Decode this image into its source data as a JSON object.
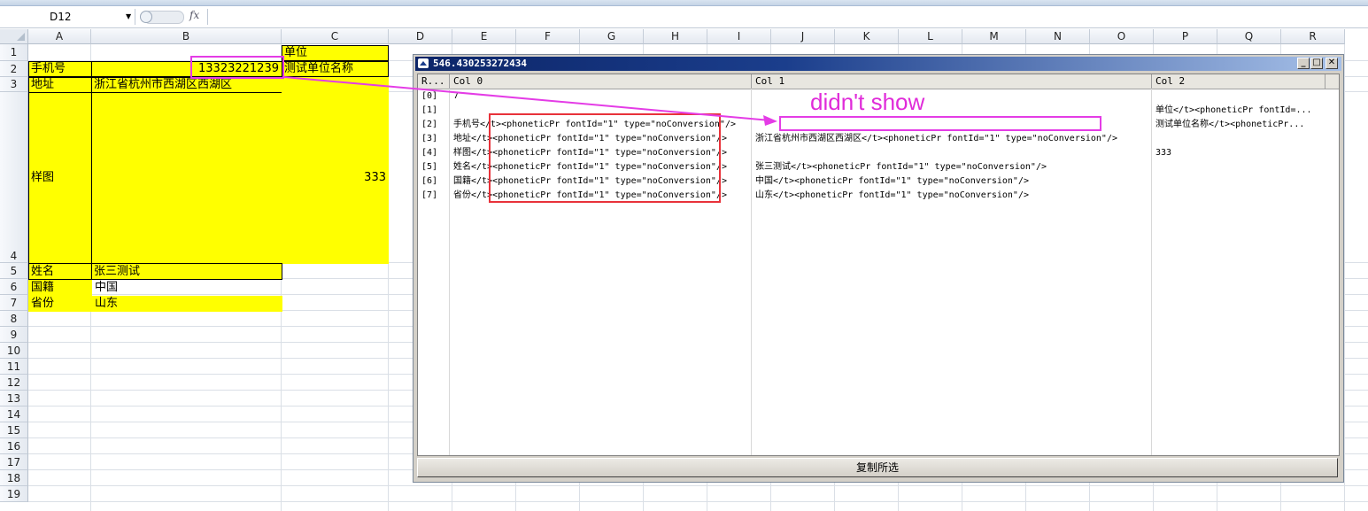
{
  "formula_bar": {
    "name_box": "D12",
    "fx_label": "fx"
  },
  "columns": [
    "A",
    "B",
    "C",
    "D",
    "E",
    "F",
    "G",
    "H",
    "I",
    "J",
    "K",
    "L",
    "M",
    "N",
    "O",
    "P",
    "Q",
    "R"
  ],
  "rows": [
    "1",
    "2",
    "3",
    "4",
    "5",
    "6",
    "7",
    "8",
    "9",
    "10",
    "11",
    "12",
    "13",
    "14",
    "15",
    "16",
    "17",
    "18",
    "19"
  ],
  "cells": {
    "C1": "单位",
    "A2": "手机号",
    "B2": "13323221239",
    "C2": "测试单位名称",
    "A3": "地址",
    "B3": "浙江省杭州市西湖区西湖区",
    "A4": "样图",
    "C4": "333",
    "A5": "姓名",
    "B5": "张三测试",
    "A6": "国籍",
    "B6": "中国",
    "A7": "省份",
    "B7": "山东"
  },
  "dialog": {
    "title": "546.430253272434",
    "headers": [
      "R...",
      "Col 0",
      "Col 1",
      "Col 2"
    ],
    "rows": [
      {
        "idx": "[0]",
        "c0": "7",
        "c1": "",
        "c2": ""
      },
      {
        "idx": "[1]",
        "c0": "",
        "c1": "",
        "c2": "单位</t><phoneticPr fontId=..."
      },
      {
        "idx": "[2]",
        "c0": "手机号</t><phoneticPr fontId=\"1\" type=\"noConversion\"/>",
        "c1": "",
        "c2": "测试单位名称</t><phoneticPr..."
      },
      {
        "idx": "[3]",
        "c0": "地址</t><phoneticPr fontId=\"1\" type=\"noConversion\"/>",
        "c1": "浙江省杭州市西湖区西湖区</t><phoneticPr fontId=\"1\" type=\"noConversion\"/>",
        "c2": ""
      },
      {
        "idx": "[4]",
        "c0": "样图</t><phoneticPr fontId=\"1\" type=\"noConversion\"/>",
        "c1": "",
        "c2": "333"
      },
      {
        "idx": "[5]",
        "c0": "姓名</t><phoneticPr fontId=\"1\" type=\"noConversion\"/>",
        "c1": "张三测试</t><phoneticPr fontId=\"1\" type=\"noConversion\"/>",
        "c2": ""
      },
      {
        "idx": "[6]",
        "c0": "国籍</t><phoneticPr fontId=\"1\" type=\"noConversion\"/>",
        "c1": "中国</t><phoneticPr fontId=\"1\" type=\"noConversion\"/>",
        "c2": ""
      },
      {
        "idx": "[7]",
        "c0": "省份</t><phoneticPr fontId=\"1\" type=\"noConversion\"/>",
        "c1": "山东</t><phoneticPr fontId=\"1\" type=\"noConversion\"/>",
        "c2": ""
      }
    ],
    "copy_button": "复制所选"
  },
  "annotation": {
    "text": "didn't show"
  },
  "colors": {
    "highlight": "#ffff00",
    "red_box": "#e8323a",
    "magenta": "#e43ce6"
  }
}
